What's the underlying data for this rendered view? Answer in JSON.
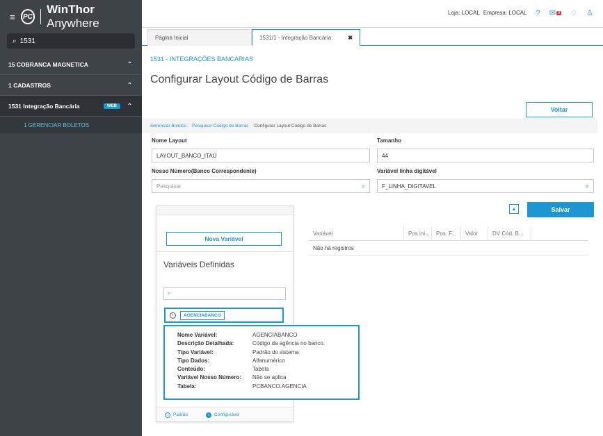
{
  "sidebar": {
    "brand": "WinThor",
    "brand_suffix": "Anywhere",
    "logo_text": "PC",
    "search_value": "1531",
    "items": [
      {
        "label": "15  COBRANCA MAGNETICA"
      },
      {
        "label": "1  CADASTROS"
      },
      {
        "label": "1531  Integração Bancária",
        "badge": "WEB"
      }
    ],
    "subitem": "1  GERENCIAR BOLETOS"
  },
  "topbar": {
    "loja": "Loja: LOCAL",
    "empresa": "Empresa: LOCAL",
    "mail_count": "0"
  },
  "tabs": [
    {
      "label": "Página Inicial"
    },
    {
      "label": "1531/1 - Integração Bancária",
      "close": "✖"
    }
  ],
  "main": {
    "section_title": "1531 - INTEGRAÇÕES BANCÁRIAS",
    "page_title": "Configurar Layout Código de Barras",
    "voltar_label": "Voltar",
    "breadcrumb": [
      "Gerenciar Boletos",
      "Pesquisar Código de Barras",
      "Configurar Layout Código de Barras"
    ],
    "fields": {
      "nome_layout_label": "Nome Layout",
      "nome_layout_value": "LAYOUT_BANCO_ITAÚ",
      "tamanho_label": "Tamanho",
      "tamanho_value": "44",
      "nosso_numero_label": "Nosso Número(Banco Correspondente)",
      "nosso_numero_placeholder": "Pesquisar",
      "variavel_linha_label": "Variável linha digitável",
      "variavel_linha_value": "F_LINHA_DIGITAVEL"
    },
    "salvar_label": "Salvar"
  },
  "variables_panel": {
    "nova_variavel_label": "Nova Variável",
    "title": "Variáveis Definidas",
    "item_tag": "AGENCIABANCO",
    "legend_padrao": "Padrão",
    "legend_configuravel": "Configurável"
  },
  "tooltip": {
    "rows": [
      {
        "k": "Nome Variável:",
        "v": "AGENCIABANCO"
      },
      {
        "k": "Descrição Detalhada:",
        "v": "Código da agência no banco."
      },
      {
        "k": "Tipo Variável:",
        "v": "Padrão do sistema"
      },
      {
        "k": "Tipo Dados:",
        "v": "Alfanumérico"
      },
      {
        "k": "Conteúdo:",
        "v": "Tabela"
      },
      {
        "k": "Variável Nosso Número:",
        "v": "Não se aplica"
      },
      {
        "k": "Tabela:",
        "v": "PCBANCO.AGENCIA"
      }
    ]
  },
  "table": {
    "columns": [
      "Variável",
      "Pos.ini...",
      "Pos. F...",
      "Valor",
      "DV Cód. B..."
    ],
    "empty_text": "Não há registros"
  }
}
